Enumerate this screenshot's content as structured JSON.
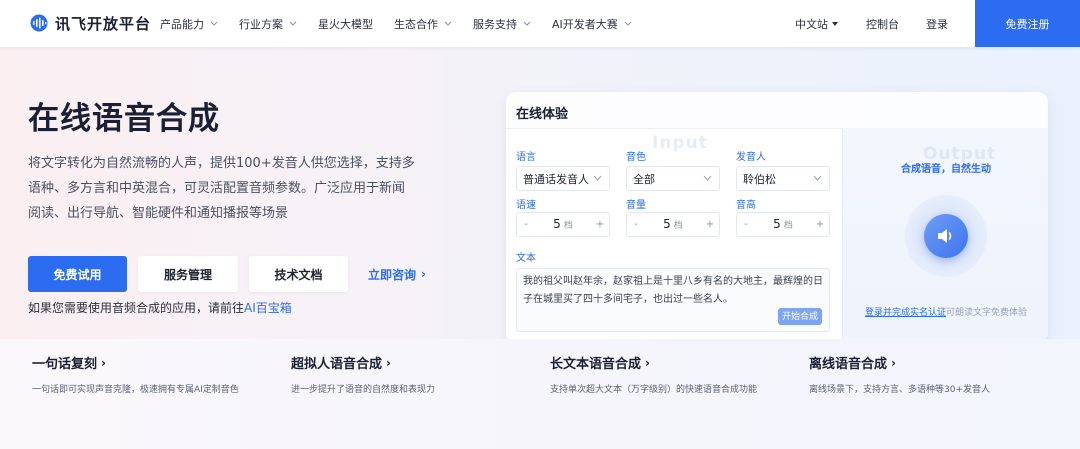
{
  "nav": {
    "logo_text": "讯飞开放平台",
    "menu": [
      {
        "label": "产品能力",
        "has_dropdown": true
      },
      {
        "label": "行业方案",
        "has_dropdown": true
      },
      {
        "label": "星火大模型",
        "has_dropdown": false
      },
      {
        "label": "生态合作",
        "has_dropdown": true
      },
      {
        "label": "服务支持",
        "has_dropdown": true
      },
      {
        "label": "AI开发者大赛",
        "has_dropdown": true
      }
    ],
    "language": "中文站",
    "console": "控制台",
    "login": "登录",
    "register": "免费注册"
  },
  "hero": {
    "title": "在线语音合成",
    "description": "将文字转化为自然流畅的人声，提供100+发音人供您选择，支持多语种、多方言和中英混合，可灵活配置音频参数。广泛应用于新闻阅读、出行导航、智能硬件和通知播报等场景",
    "buttons": {
      "trial": "免费试用",
      "service": "服务管理",
      "docs": "技术文档",
      "consult": "立即咨询",
      "consult_arrow": "›"
    },
    "hint_prefix": "如果您需要使用音频合成的应用，请前往",
    "hint_link": "AI百宝箱"
  },
  "demo": {
    "title": "在线体验",
    "input_watermark": "Input",
    "output_watermark": "Output",
    "language_label": "语言",
    "language_value": "普通话发音人",
    "timbre_label": "音色",
    "timbre_value": "全部",
    "speaker_label": "发音人",
    "speaker_value": "聆伯松",
    "speed_label": "语速",
    "speed_value": "5",
    "volume_label": "音量",
    "volume_value": "5",
    "pitch_label": "音高",
    "pitch_value": "5",
    "unit": "档",
    "minus": "-",
    "plus": "+",
    "text_label": "文本",
    "text_value": "我的祖父叫赵年余，赵家祖上是十里八乡有名的大地主，最辉煌的日子在城里买了四十多间宅子，也出过一些名人。",
    "synth_button": "开始合成",
    "output_subtitle": "合成语音，自然生动",
    "output_note_link": "登录并完成实名认证",
    "output_note_rest": "可朗读文字免费体验"
  },
  "features": [
    {
      "title": "一句话复刻",
      "desc": "一句话即可实现声音克隆，极速拥有专属AI定制音色"
    },
    {
      "title": "超拟人语音合成",
      "desc": "进一步提升了语音的自然度和表现力"
    },
    {
      "title": "长文本语音合成",
      "desc": "支持单次超大文本（万字级别）的快速语音合成功能"
    },
    {
      "title": "离线语音合成",
      "desc": "离线场景下，支持方言、多语种等30+发音人"
    }
  ],
  "feature_arrow": "›",
  "colors": {
    "brand_blue": "#2b6cf0",
    "text_dark": "#1a1f33",
    "hero_bg_left": "#fbeff2",
    "hero_bg_right": "#eaf1fd"
  },
  "icons": [
    "logo-wave-icon",
    "chevron-down-icon",
    "caret-down-icon",
    "speaker-icon",
    "arrow-right-icon"
  ]
}
